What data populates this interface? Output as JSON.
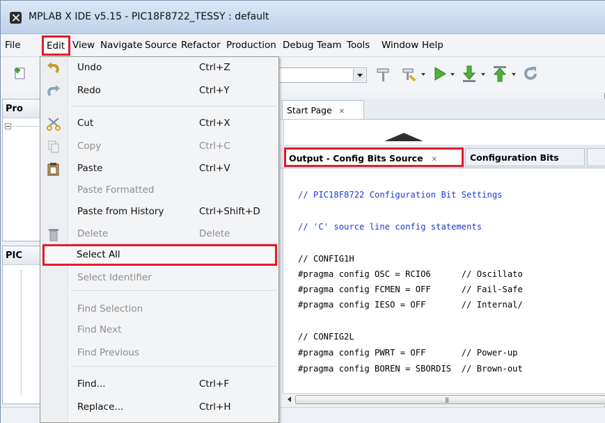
{
  "window": {
    "title": "MPLAB X IDE v5.15 - PIC18F8722_TESSY : default"
  },
  "menubar": {
    "items": [
      "File",
      "Edit",
      "View",
      "Navigate",
      "Source",
      "Refactor",
      "Production",
      "Debug",
      "Team",
      "Tools",
      "Window",
      "Help"
    ]
  },
  "left_panels": {
    "top_title": "Pro",
    "bottom_title": "PIC"
  },
  "editor": {
    "start_tab": "Start Page",
    "output_tab": "Output - Config Bits Source",
    "config_tab": "Configuration Bits",
    "code_lines": [
      "// PIC18F8722 Configuration Bit Settings",
      "",
      "// 'C' source line config statements",
      "",
      "// CONFIG1H",
      "#pragma config OSC = RCIO6      // Oscillato",
      "#pragma config FCMEN = OFF      // Fail-Safe",
      "#pragma config IESO = OFF       // Internal/",
      "",
      "// CONFIG2L",
      "#pragma config PWRT = OFF       // Power-up",
      "#pragma config BOREN = SBORDIS  // Brown-out"
    ]
  },
  "edit_menu": {
    "items": [
      {
        "label": "Undo",
        "shortcut": "Ctrl+Z",
        "disabled": false,
        "icon": "undo-icon"
      },
      {
        "label": "Redo",
        "shortcut": "Ctrl+Y",
        "disabled": false,
        "icon": "redo-icon"
      },
      {
        "label": "Cut",
        "shortcut": "Ctrl+X",
        "disabled": false,
        "icon": "cut-icon"
      },
      {
        "label": "Copy",
        "shortcut": "Ctrl+C",
        "disabled": true,
        "icon": "copy-icon"
      },
      {
        "label": "Paste",
        "shortcut": "Ctrl+V",
        "disabled": false,
        "icon": "paste-icon"
      },
      {
        "label": "Paste Formatted",
        "shortcut": "",
        "disabled": true,
        "icon": ""
      },
      {
        "label": "Paste from History",
        "shortcut": "Ctrl+Shift+D",
        "disabled": false,
        "icon": ""
      },
      {
        "label": "Delete",
        "shortcut": "Delete",
        "disabled": true,
        "icon": "delete-icon"
      },
      {
        "label": "Select All",
        "shortcut": "",
        "disabled": false,
        "icon": ""
      },
      {
        "label": "Select Identifier",
        "shortcut": "",
        "disabled": true,
        "icon": ""
      },
      {
        "label": "Find Selection",
        "shortcut": "",
        "disabled": true,
        "icon": ""
      },
      {
        "label": "Find Next",
        "shortcut": "",
        "disabled": true,
        "icon": ""
      },
      {
        "label": "Find Previous",
        "shortcut": "",
        "disabled": true,
        "icon": ""
      },
      {
        "label": "Find...",
        "shortcut": "Ctrl+F",
        "disabled": false,
        "icon": ""
      },
      {
        "label": "Replace...",
        "shortcut": "Ctrl+H",
        "disabled": false,
        "icon": ""
      }
    ]
  },
  "colors": {
    "highlight_box": "#e31b2a",
    "code_comment": "#1a3cd6"
  }
}
